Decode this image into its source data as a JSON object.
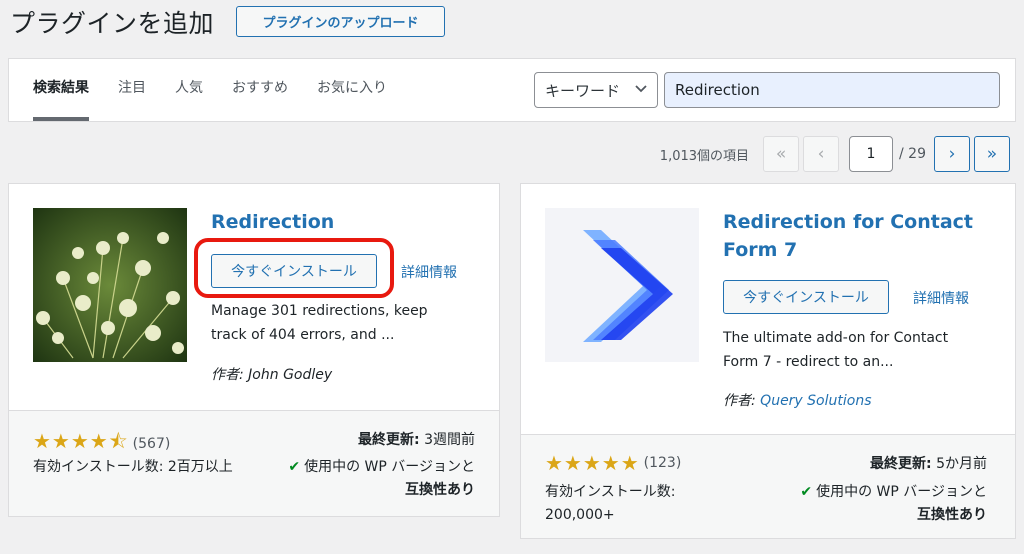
{
  "header": {
    "title": "プラグインを追加",
    "upload_label": "プラグインのアップロード"
  },
  "filter": {
    "tabs": [
      "検索結果",
      "注目",
      "人気",
      "おすすめ",
      "お気に入り"
    ],
    "active_tab": "検索結果",
    "search_type": "キーワード",
    "search_value": "Redirection"
  },
  "pagination": {
    "item_count": "1,013個の項目",
    "first": "«",
    "prev": "‹",
    "current_page": "1",
    "total_pages": "/ 29",
    "next": "›",
    "last": "»"
  },
  "plugins": [
    {
      "name": "Redirection",
      "install_label": "今すぐインストール",
      "details_label": "詳細情報",
      "description": "Manage 301 redirections, keep track of 404 errors, and ...",
      "author_prefix": "作者:",
      "author": "John Godley",
      "rating": 4.5,
      "stars": "★★★★⯪",
      "rating_count": "(567)",
      "updated_label": "最終更新:",
      "updated_value": "3週間前",
      "installs": "有効インストール数: 2百万以上",
      "compat_text": "使用中の WP バージョンと",
      "compat_bold": "互換性あり"
    },
    {
      "name": "Redirection for Contact Form 7",
      "install_label": "今すぐインストール",
      "details_label": "詳細情報",
      "description": "The ultimate add-on for Contact Form 7 - redirect to an...",
      "author_prefix": "作者:",
      "author": "Query Solutions",
      "rating": 5,
      "stars": "★★★★★",
      "rating_count": "(123)",
      "updated_label": "最終更新:",
      "updated_value": "5か月前",
      "installs": "有効インストール数: 200,000+",
      "compat_text": "使用中の WP バージョンと",
      "compat_bold": "互換性あり"
    }
  ],
  "colors": {
    "accent": "#2271b1",
    "star": "#dba617",
    "highlight": "#e8190f",
    "check": "#008a20"
  }
}
